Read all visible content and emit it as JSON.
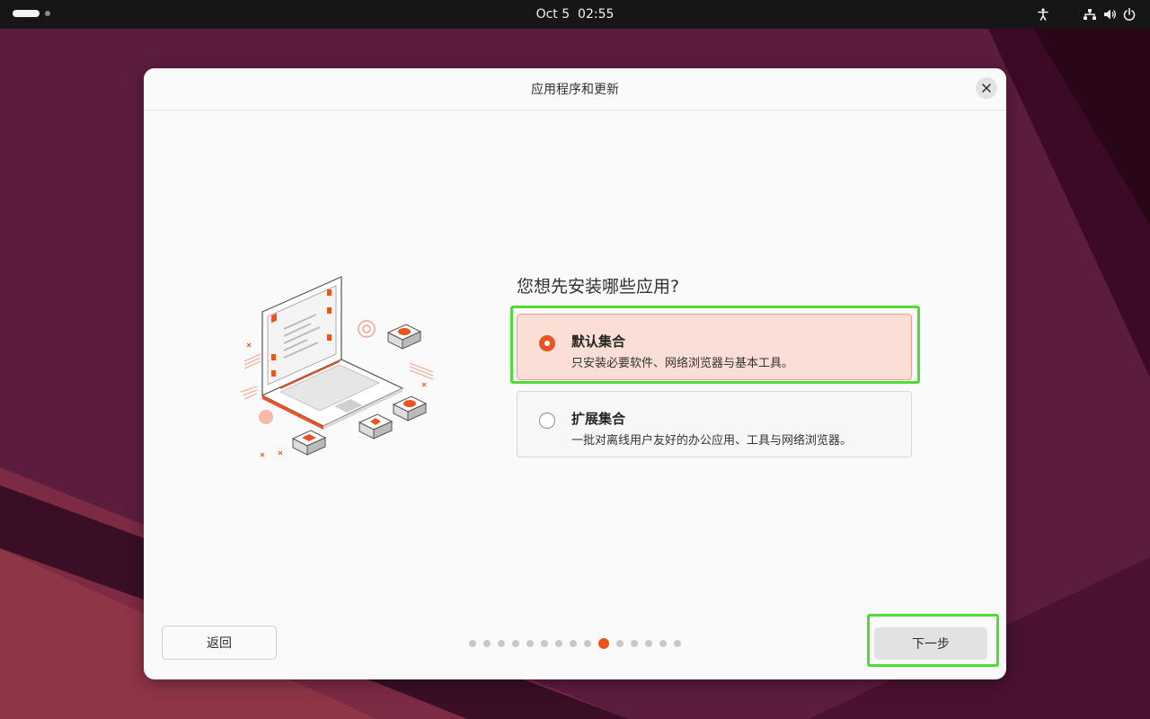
{
  "topbar": {
    "clock": "Oct 5  02:55",
    "icons": [
      "activities-indicator",
      "accessibility-icon",
      "network-icon",
      "volume-icon",
      "power-icon"
    ]
  },
  "dialog": {
    "title": "应用程序和更新",
    "close_icon": "close-icon",
    "question": "您想先安装哪些应用?",
    "options": [
      {
        "title": "默认集合",
        "description": "只安装必要软件、网络浏览器与基本工具。",
        "selected": true
      },
      {
        "title": "扩展集合",
        "description": "一批对离线用户友好的办公应用、工具与网络浏览器。",
        "selected": false
      }
    ],
    "back_label": "返回",
    "next_label": "下一步",
    "pager": {
      "total": 15,
      "current": 10
    }
  },
  "colors": {
    "accent": "#E95420",
    "selected_bg": "#FBDFD6",
    "highlight": "#4CDC34",
    "topbar": "#161616"
  }
}
